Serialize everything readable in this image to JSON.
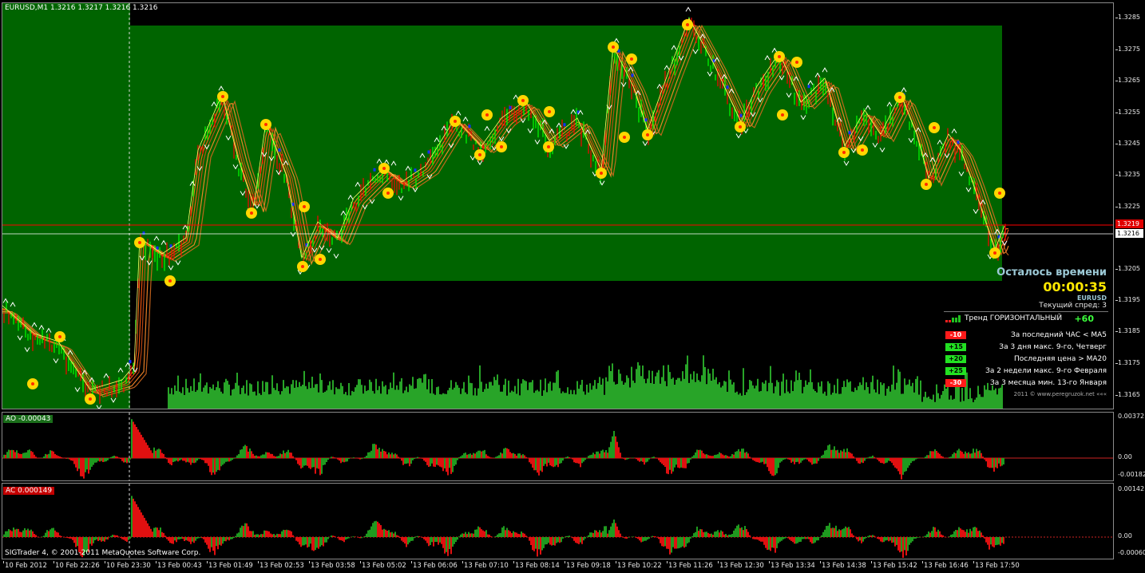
{
  "chart": {
    "symbol_label": "EURUSD,M1  1.3216 1.3217 1.3216 1.3216",
    "ask_tag": "1.3219",
    "bid_tag": "1.3216",
    "price_ticks": [
      "1.3285",
      "1.3275",
      "1.3265",
      "1.3255",
      "1.3245",
      "1.3235",
      "1.3225",
      "1.3216",
      "1.3205",
      "1.3195",
      "1.3185",
      "1.3175",
      "1.3165"
    ],
    "time_labels": [
      "10 Feb 2012",
      "10 Feb 22:26",
      "10 Feb 23:30",
      "13 Feb 00:43",
      "13 Feb 01:49",
      "13 Feb 02:53",
      "13 Feb 03:58",
      "13 Feb 05:02",
      "13 Feb 06:06",
      "13 Feb 07:10",
      "13 Feb 08:14",
      "13 Feb 09:18",
      "13 Feb 10:22",
      "13 Feb 11:26",
      "13 Feb 12:30",
      "13 Feb 13:34",
      "13 Feb 14:38",
      "13 Feb 15:42",
      "13 Feb 16:46",
      "13 Feb 17:50"
    ],
    "colors": {
      "background": "#000000",
      "channel": "#006400",
      "bull_candle": "#00ff00",
      "bear_candle": "#ff0000",
      "ma": "#ff6a00",
      "volume": "#32cd32",
      "fractal": "#ffd700",
      "ask_line": "#ff0000",
      "bid_line": "#ffffff"
    }
  },
  "ao": {
    "label": "AO -0.00043",
    "ticks": [
      "0.00372",
      "0.00",
      "-0.00182"
    ]
  },
  "ac": {
    "label": "AC 0.000149",
    "ticks": [
      "0.00142",
      "0.00",
      "-0.00060"
    ]
  },
  "info_panel": {
    "timer_title": "Осталось времени",
    "timer_value": "00:00:35",
    "timer_symbol": "EURUSD",
    "spread": "Текущий спред: 3",
    "trend_label": "Тренд ГОРИЗОНТАЛЬНЫЙ",
    "trend_score": "+60",
    "factors": [
      {
        "badge": "-10",
        "text": "За последний ЧАС < MA5",
        "sign": "neg"
      },
      {
        "badge": "+15",
        "text": "За 3 дня макс. 9-го, Четверг",
        "sign": "pos"
      },
      {
        "badge": "+20",
        "text": "Последняя цена > MA20",
        "sign": "pos"
      },
      {
        "badge": "+25",
        "text": "За 2 недели макс. 9-го Февраля",
        "sign": "pos"
      },
      {
        "badge": "-30",
        "text": "За 3 месяца мин. 13-го Января",
        "sign": "neg"
      }
    ],
    "footer": "2011 © www.peregruzok.net   «««"
  },
  "copyright": "SIGTrader 4, © 2001-2011 MetaQuotes Software Corp."
}
